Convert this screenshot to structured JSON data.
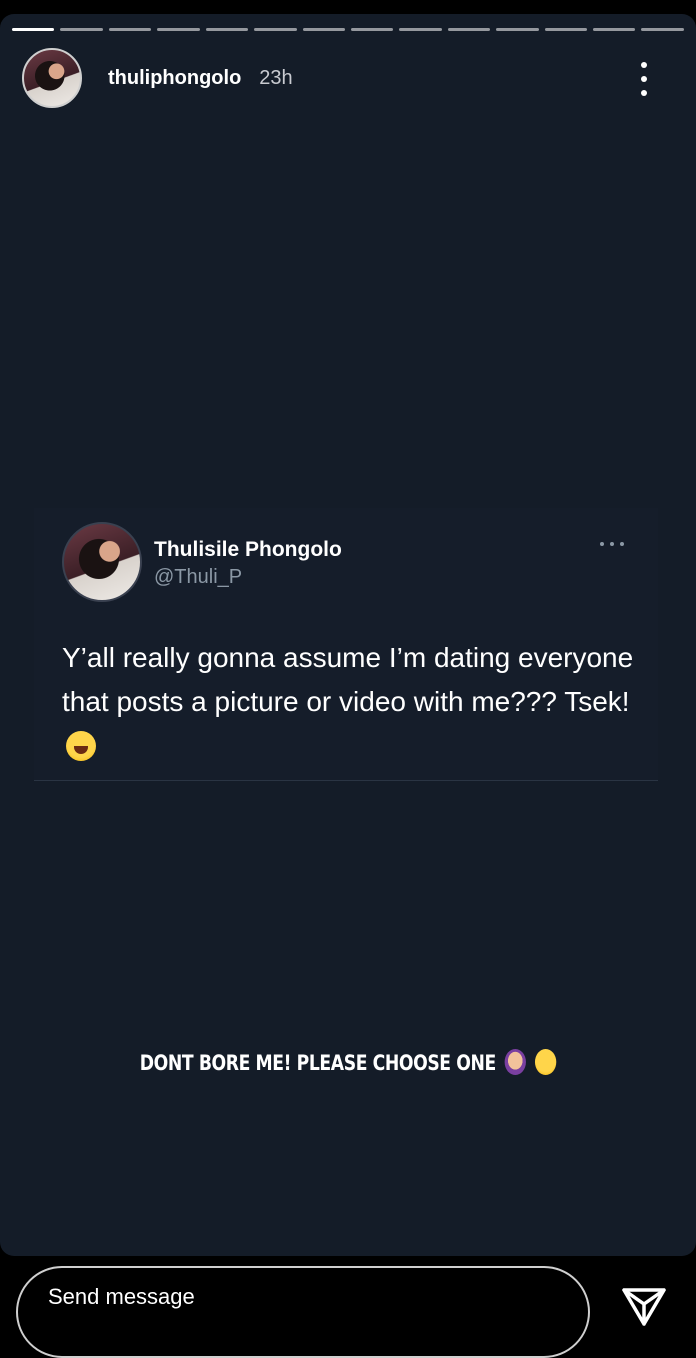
{
  "story": {
    "progress_segments": 14,
    "progress_completed": 1,
    "username": "thuliphongolo",
    "time": "23h",
    "icons": {
      "more": "more-vertical-icon",
      "send": "send-icon"
    }
  },
  "tweet": {
    "display_name": "Thulisile Phongolo",
    "handle": "@Thuli_P",
    "text": "Y’all really gonna assume I’m dating everyone that posts a picture or video with me??? Tsek!"
  },
  "caption": {
    "text": "DONT BORE ME! PLEASE CHOOSE ONE"
  },
  "footer": {
    "message_placeholder": "Send message"
  },
  "colors": {
    "story_bg": "#141c28",
    "page_bg": "#000000",
    "handle": "#8b98a5"
  }
}
